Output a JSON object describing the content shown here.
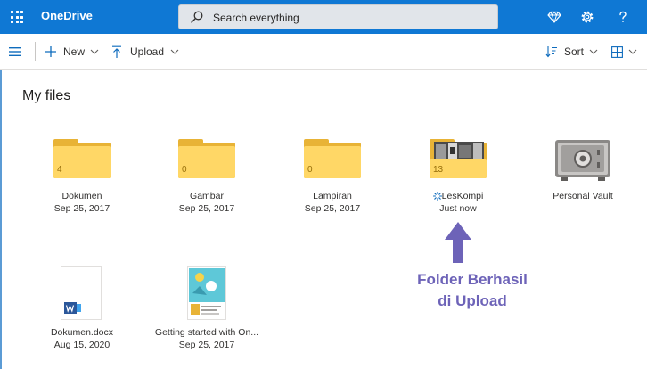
{
  "app": {
    "title": "OneDrive"
  },
  "search": {
    "placeholder": "Search everything"
  },
  "toolbar": {
    "new_label": "New",
    "upload_label": "Upload",
    "sort_label": "Sort"
  },
  "page": {
    "title": "My files"
  },
  "files": [
    {
      "name": "Dokumen",
      "date": "Sep 25, 2017",
      "type": "folder",
      "count": "4"
    },
    {
      "name": "Gambar",
      "date": "Sep 25, 2017",
      "type": "folder",
      "count": "0"
    },
    {
      "name": "Lampiran",
      "date": "Sep 25, 2017",
      "type": "folder",
      "count": "0"
    },
    {
      "name": "LesKompi",
      "date": "Just now",
      "type": "folder",
      "count": "13"
    },
    {
      "name": "Personal Vault",
      "date": "",
      "type": "vault"
    },
    {
      "name": "Dokumen.docx",
      "date": "Aug 15, 2020",
      "type": "word"
    },
    {
      "name": "Getting started with On...",
      "date": "Sep 25, 2017",
      "type": "pdf"
    }
  ],
  "annotation": {
    "line1": "Folder Berhasil",
    "line2": "di Upload"
  },
  "colors": {
    "header": "#0f78d4",
    "folder": "#ffd766",
    "folder_back": "#e8b336",
    "annotation": "#6d63b8",
    "word": "#2b579a"
  },
  "icons": [
    "app-launcher-icon",
    "search-icon",
    "diamond-icon",
    "gear-icon",
    "help-icon",
    "hamburger-icon",
    "plus-icon",
    "chevron-down-icon",
    "upload-icon",
    "sort-icon",
    "view-grid-icon",
    "sync-icon",
    "arrow-up-icon"
  ]
}
